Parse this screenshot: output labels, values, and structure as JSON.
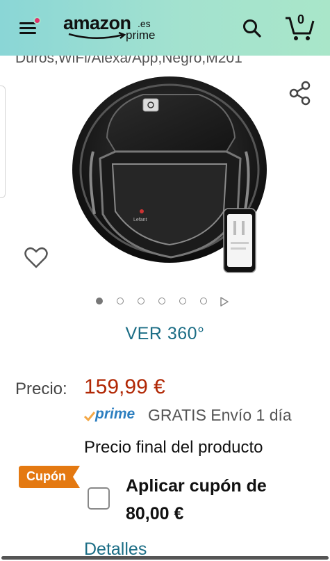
{
  "header": {
    "logo_word": "amazon",
    "logo_tld": ".es",
    "logo_sub": "prime",
    "cart_count": "0",
    "background": "#a3e2cf",
    "notification_color": "#e0316a"
  },
  "product": {
    "title_fragment": "Duros,WiFi/Alexa/App,Negro,M201",
    "image_brand": "Lefant",
    "gallery": {
      "total_images": 6,
      "active_index": 0
    },
    "view_360_label": "VER 360°"
  },
  "pricing": {
    "price_label": "Precio:",
    "price_value": "159,99 €",
    "price_color": "#b12704",
    "prime_label": "prime",
    "shipping_text": "GRATIS Envío 1 día",
    "final_price_text": "Precio final del producto"
  },
  "coupon": {
    "badge_label": "Cupón",
    "badge_color": "#e47911",
    "apply_line1": "Aplicar cupón de",
    "apply_line2": "80,00 €",
    "checked": false,
    "details_link": "Detalles"
  },
  "icons": {
    "menu": "menu-icon",
    "search": "search-icon",
    "cart": "cart-icon",
    "share": "share-icon",
    "wishlist": "heart-icon",
    "next": "play-icon"
  }
}
